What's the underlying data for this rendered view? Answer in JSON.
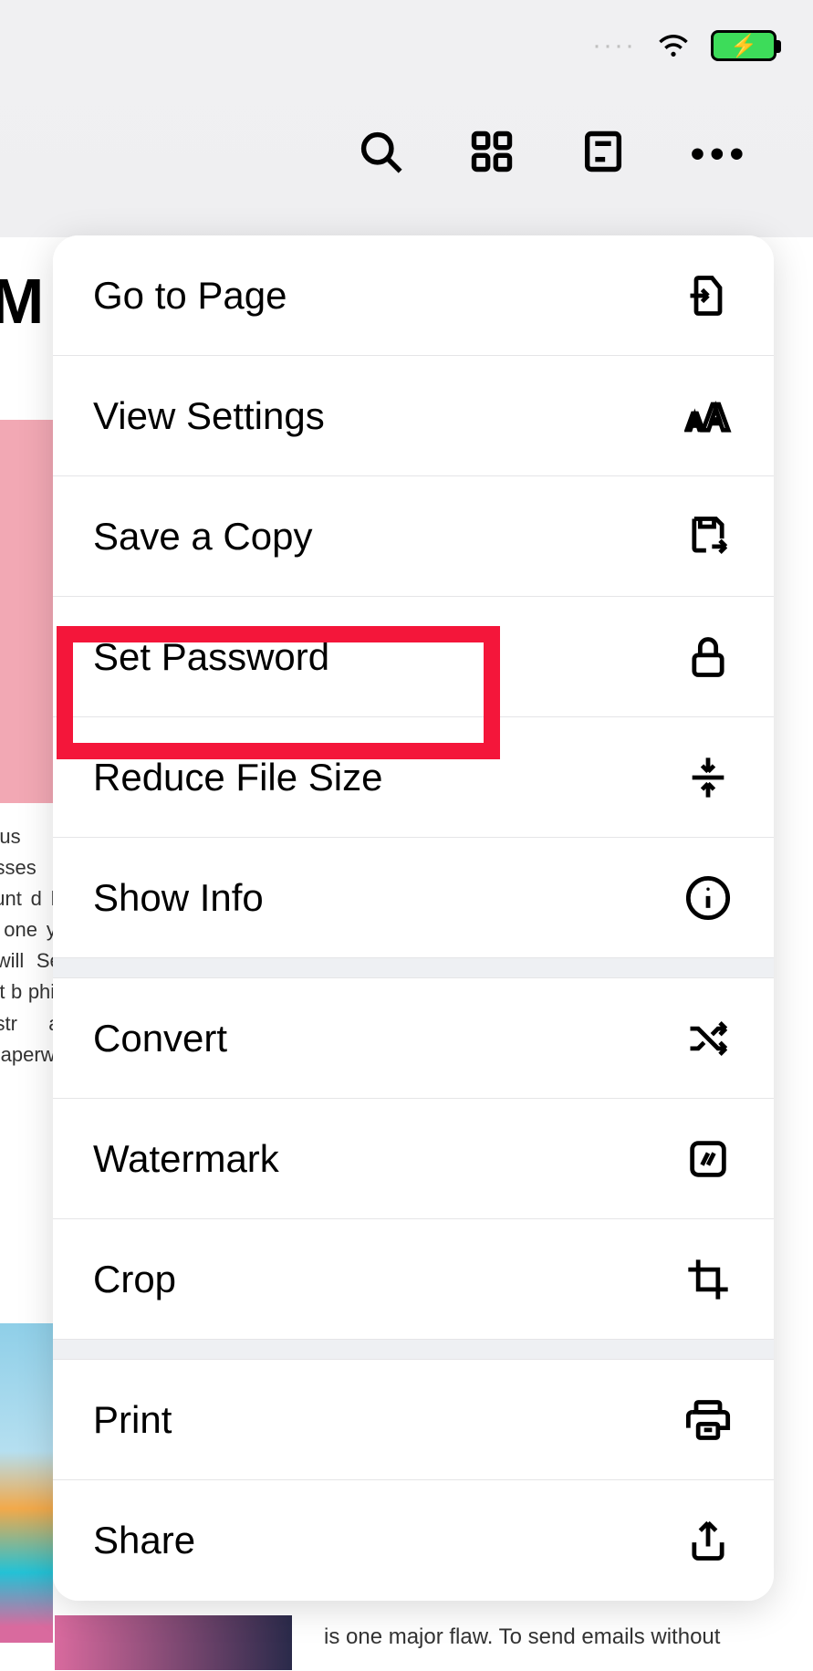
{
  "status": {
    "dots": "····"
  },
  "toolbar": {
    "search": "search",
    "grid": "grid",
    "page": "page",
    "more": "•••"
  },
  "background": {
    "title_fragment": "M",
    "body_fragment": " indus nesses count d liab ne one y to p  will  Seco test b phic o dustr and pa aperw  by s",
    "footer_fragment": "is  one  major  flaw.  To  send  emails  without"
  },
  "menu": {
    "groups": [
      [
        "go_to_page",
        "view_settings",
        "save_a_copy",
        "set_password",
        "reduce_file_size",
        "show_info"
      ],
      [
        "convert",
        "watermark",
        "crop"
      ],
      [
        "print",
        "share"
      ]
    ],
    "items": {
      "go_to_page": {
        "label": "Go to Page",
        "icon": "page-arrow-icon"
      },
      "view_settings": {
        "label": "View Settings",
        "icon": "text-size-icon"
      },
      "save_a_copy": {
        "label": "Save a Copy",
        "icon": "floppy-export-icon"
      },
      "set_password": {
        "label": "Set Password",
        "icon": "lock-icon"
      },
      "reduce_file_size": {
        "label": "Reduce File Size",
        "icon": "compress-icon"
      },
      "show_info": {
        "label": "Show Info",
        "icon": "info-icon"
      },
      "convert": {
        "label": "Convert",
        "icon": "shuffle-icon"
      },
      "watermark": {
        "label": "Watermark",
        "icon": "watermark-icon"
      },
      "crop": {
        "label": "Crop",
        "icon": "crop-icon"
      },
      "print": {
        "label": "Print",
        "icon": "printer-icon"
      },
      "share": {
        "label": "Share",
        "icon": "share-icon"
      }
    }
  },
  "highlight": "set_password"
}
